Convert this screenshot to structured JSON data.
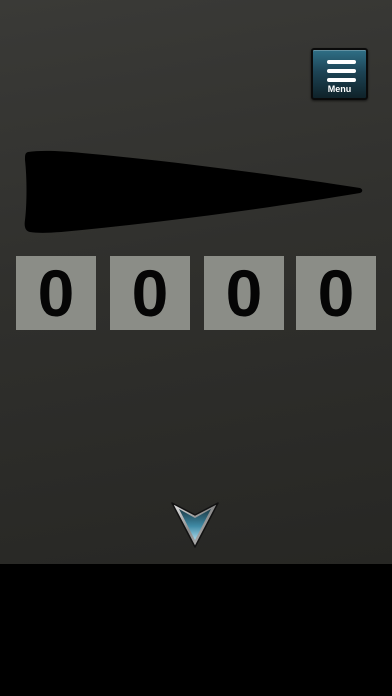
{
  "menu": {
    "label": "Menu",
    "icon": "hamburger-icon",
    "color": "#1d4455"
  },
  "combination": {
    "digits": [
      "0",
      "0",
      "0",
      "0"
    ],
    "tile_color": "#8b8d87"
  },
  "navigation": {
    "down_icon": "chevron-down-icon"
  },
  "scene": {
    "background_color": "#30302d"
  }
}
